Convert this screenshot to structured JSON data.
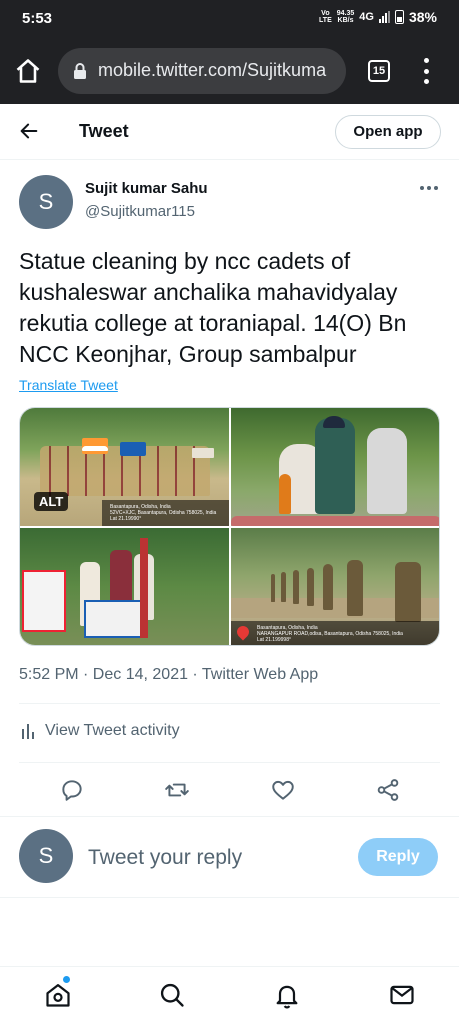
{
  "status_bar": {
    "time": "5:53",
    "volte": "Vo\nLTE",
    "speed": "94.35\nKB/s",
    "network": "4G",
    "battery": "38%"
  },
  "browser": {
    "url": "mobile.twitter.com/Sujitkuma",
    "tab_count": "15"
  },
  "header": {
    "title": "Tweet",
    "open_app": "Open app"
  },
  "tweet": {
    "avatar_letter": "S",
    "author_name": "Sujit kumar Sahu",
    "author_handle": "@Sujitkumar115",
    "text": "Statue cleaning  by ncc cadets of kushaleswar anchalika mahavidyalay rekutia college  at toraniapal. 14(O) Bn NCC Keonjhar, Group sambalpur",
    "translate": "Translate Tweet",
    "alt_badge": "ALT",
    "photo1_caption": "Basantapura, Odisha, India\n52VC+XJC, Basantapura, Odisha 758025, India\nLat 21.19990°",
    "photo4_caption": "Basantapura, Odisha, India\nNARANGAPUR ROAD,odisa, Basantapura, Odisha 758025, India\nLat 21.199998°",
    "meta": "5:52 PM · Dec 14, 2021 · Twitter Web App",
    "activity": "View Tweet activity"
  },
  "reply": {
    "avatar_letter": "S",
    "placeholder": "Tweet your reply",
    "button": "Reply"
  },
  "colors": {
    "accent": "#1d9bf0",
    "reply_button": "#8ecdf8",
    "secondary_text": "#536471"
  }
}
